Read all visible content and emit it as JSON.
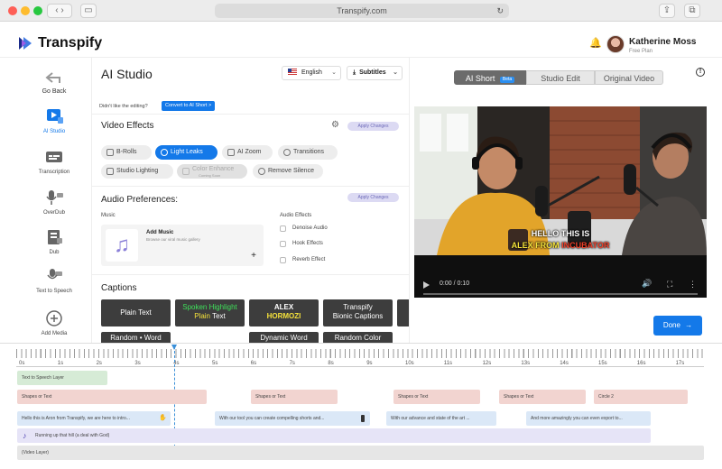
{
  "browser": {
    "url": "Transpify.com"
  },
  "header": {
    "brand": "Transpify",
    "user_name": "Katherine Moss",
    "user_plan": "Free Plan"
  },
  "leftnav": {
    "back_label": "Go Back",
    "items": [
      {
        "label": "AI Studio",
        "icon": "ai-studio-icon"
      },
      {
        "label": "Transcription",
        "icon": "transcription-icon"
      },
      {
        "label": "OverDub",
        "icon": "overdub-icon"
      },
      {
        "label": "Dub",
        "icon": "dub-icon"
      },
      {
        "label": "Text to Speech",
        "icon": "text-to-speech-icon"
      },
      {
        "label": "Add Media",
        "icon": "add-media-icon"
      }
    ]
  },
  "studio": {
    "title": "AI Studio",
    "language": "English",
    "subtitles_label": "Subtitles",
    "prompt_text": "Didn't like the editing?",
    "convert_label": "Convert to AI Short",
    "video_effects_title": "Video Effects",
    "apply_label": "Apply Changes",
    "effects": [
      {
        "label": "B-Rolls",
        "state": "normal"
      },
      {
        "label": "Light Leaks",
        "state": "active"
      },
      {
        "label": "AI Zoom",
        "state": "normal"
      },
      {
        "label": "Transitions",
        "state": "normal"
      },
      {
        "label": "Studio Lighting",
        "state": "normal"
      },
      {
        "label": "Color Enhance",
        "state": "disabled",
        "sublabel": "Coming Soon"
      },
      {
        "label": "Remove Silence",
        "state": "normal"
      }
    ],
    "audio_title": "Audio Preferences:",
    "music_label": "Music",
    "add_music_title": "Add Music",
    "add_music_sub": "Browse our viral music gallery",
    "audio_effects_label": "Audio Effects",
    "audio_effects": [
      "Denoise Audio",
      "Hook Effects",
      "Reverb Effect"
    ],
    "captions_title": "Captions",
    "captions": [
      {
        "lines": [
          "Plain Text"
        ]
      },
      {
        "lines": [
          "Spoken Highlight",
          "Plain Text"
        ]
      },
      {
        "lines": [
          "ALEX",
          "HORMOZI"
        ]
      },
      {
        "lines": [
          "Transpify",
          "Bionic Captions"
        ]
      }
    ],
    "captions_row2": [
      "Random • Word",
      "Dynamic Word",
      "Random Color"
    ]
  },
  "preview": {
    "tabs": [
      {
        "label": "AI Short",
        "badge": "Beta"
      },
      {
        "label": "Studio Edit"
      },
      {
        "label": "Original Video"
      }
    ],
    "caption_line1": "HELLO THIS IS",
    "caption_line2": "ALEX FROM",
    "caption_line2_highlight": "INCUBATOR",
    "time_display": "0:00 / 0:10",
    "done_label": "Done"
  },
  "timeline": {
    "seconds": [
      "0s",
      "1s",
      "2s",
      "3s",
      "4s",
      "5s",
      "6s",
      "7s",
      "8s",
      "9s",
      "10s",
      "11s",
      "12s",
      "13s",
      "14s",
      "15s",
      "16s",
      "17s"
    ],
    "playhead_seconds": 4,
    "tracks": {
      "tts": "Text to Speech Layer",
      "shapes": [
        "Shapes or Text",
        "Shapes or Text",
        "Shapes or Text",
        "Shapes or Text",
        "Circle 2"
      ],
      "captions": [
        "Hello this is Aron from Transpify, we are here to intro...",
        "With our tool you can create compelling shorts and...",
        "With our advance and state of the art ...",
        "And more amazingly you can even export to..."
      ],
      "music": "Running up that hill (a deal with God)",
      "video": "(Video Layer)"
    }
  }
}
